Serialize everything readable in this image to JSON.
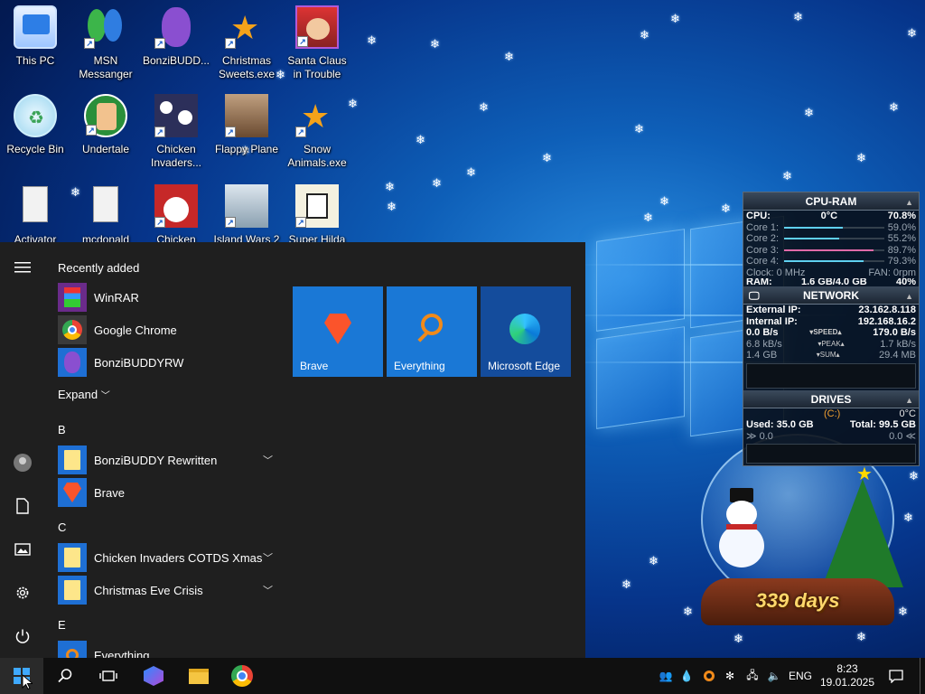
{
  "desktop_icons": [
    {
      "label": "This PC"
    },
    {
      "label": "MSN Messanger"
    },
    {
      "label": "BonziBUDD..."
    },
    {
      "label": "Christmas Sweets.exe"
    },
    {
      "label": "Santa Claus in Trouble"
    },
    {
      "label": "Recycle Bin"
    },
    {
      "label": "Undertale"
    },
    {
      "label": "Chicken Invaders..."
    },
    {
      "label": "Flappy Plane"
    },
    {
      "label": "Snow Animals.exe"
    },
    {
      "label": "Activator"
    },
    {
      "label": "mcdonald"
    },
    {
      "label": "Chicken"
    },
    {
      "label": "Island Wars 2"
    },
    {
      "label": "Super Hilda"
    }
  ],
  "start_menu": {
    "recently_added_title": "Recently added",
    "recent": [
      {
        "name": "WinRAR"
      },
      {
        "name": "Google Chrome"
      },
      {
        "name": "BonziBUDDYRW"
      }
    ],
    "expand_label": "Expand",
    "groups": [
      {
        "letter": "B",
        "items": [
          {
            "name": "BonziBUDDY Rewritten"
          },
          {
            "name": "Brave"
          }
        ]
      },
      {
        "letter": "C",
        "items": [
          {
            "name": "Chicken Invaders COTDS Xmas"
          },
          {
            "name": "Christmas Eve Crisis"
          }
        ]
      },
      {
        "letter": "E",
        "items": [
          {
            "name": "Everything"
          }
        ]
      }
    ],
    "tiles": [
      {
        "name": "Brave"
      },
      {
        "name": "Everything"
      },
      {
        "name": "Microsoft Edge"
      }
    ]
  },
  "gadget": {
    "cpu_ram": {
      "title": "CPU-RAM",
      "cpu_label": "CPU:",
      "cpu_temp": "0°C",
      "cpu_pct": "70.8%",
      "cores": [
        {
          "label": "Core 1:",
          "value": "59.0%",
          "fraction": 0.59
        },
        {
          "label": "Core 2:",
          "value": "55.2%",
          "fraction": 0.552
        },
        {
          "label": "Core 3:",
          "value": "89.7%",
          "fraction": 0.897
        },
        {
          "label": "Core 4:",
          "value": "79.3%",
          "fraction": 0.793
        }
      ],
      "clock": "Clock: 0 MHz",
      "fan": "FAN: 0rpm",
      "ram_label": "RAM:",
      "ram_value": "1.6 GB/4.0 GB",
      "ram_pct": "40%"
    },
    "network": {
      "title": "NETWORK",
      "external_label": "External IP:",
      "external_ip": "23.162.8.118",
      "internal_label": "Internal IP:",
      "internal_ip": "192.168.16.2",
      "speed_left": "0.0 B/s",
      "speed_label": "SPEED",
      "speed_right": "179.0 B/s",
      "peak_left": "6.8 kB/s",
      "peak_label": "PEAK",
      "peak_right": "1.7 kB/s",
      "sum_left": "1.4 GB",
      "sum_label": "SUM",
      "sum_right": "29.4 MB"
    },
    "drives": {
      "title": "DRIVES",
      "drive_letter": "(C:)",
      "temp": "0°C",
      "used": "Used: 35.0 GB",
      "total": "Total: 99.5 GB",
      "read": "0.0",
      "write": "0.0"
    }
  },
  "snowglobe": {
    "days": "339 days"
  },
  "taskbar": {
    "language": "ENG",
    "time": "8:23",
    "date": "19.01.2025"
  }
}
